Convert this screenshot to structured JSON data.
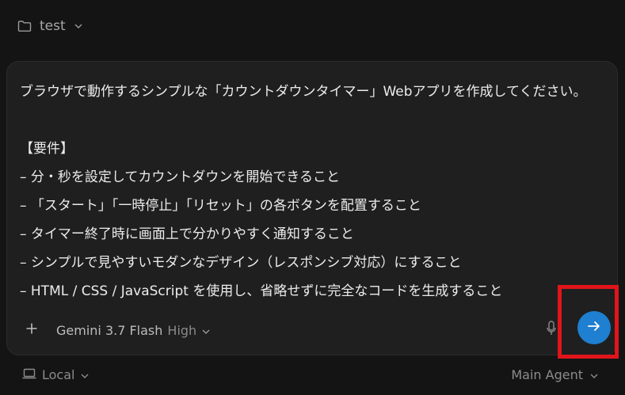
{
  "header": {
    "folder_name": "test",
    "folder_icon": "folder-icon",
    "chevron_icon": "chevron-down-icon"
  },
  "prompt": {
    "lines": [
      "ブラウザで動作するシンプルな「カウントダウンタイマー」Webアプリを作成してください。",
      "",
      "【要件】",
      "– 分・秒を設定してカウントダウンを開始できること",
      "– 「スタート」「一時停止」「リセット」の各ボタンを配置すること",
      "– タイマー終了時に画面上で分かりやすく通知すること",
      "– シンプルで見やすいモダンなデザイン（レスポンシブ対応）にすること",
      "– HTML / CSS / JavaScript を使用し、省略せずに完全なコードを生成すること"
    ]
  },
  "toolbar": {
    "plus_label": "+",
    "model_name": "Gemini 3.7 Flash",
    "model_mode": "High",
    "mic_icon": "microphone-icon",
    "send_icon": "arrow-right-icon",
    "send_color": "#1f7fd0"
  },
  "footer": {
    "location_label": "Local",
    "location_icon": "laptop-icon",
    "agent_label": "Main Agent"
  },
  "colors": {
    "background": "#141414",
    "panel": "#1f1f1f",
    "highlight": "#e0151b"
  }
}
